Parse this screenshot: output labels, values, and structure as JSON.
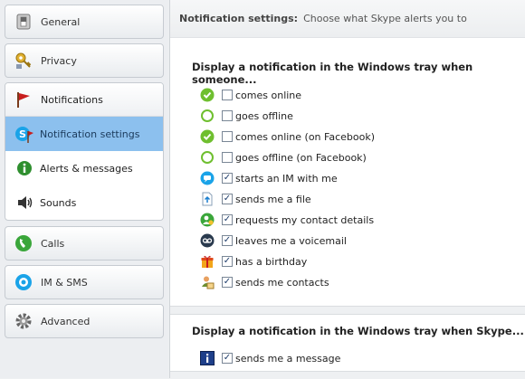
{
  "sidebar": {
    "general": {
      "label": "General",
      "icon": "switch-icon"
    },
    "privacy": {
      "label": "Privacy",
      "icon": "key-icon"
    },
    "notifications": {
      "label": "Notifications",
      "icon": "flag-icon",
      "items": [
        {
          "label": "Notification settings",
          "icon": "skype-flag-icon",
          "active": true
        },
        {
          "label": "Alerts & messages",
          "icon": "info-icon"
        },
        {
          "label": "Sounds",
          "icon": "speaker-icon"
        }
      ]
    },
    "calls": {
      "label": "Calls",
      "icon": "phone-icon"
    },
    "im_sms": {
      "label": "IM & SMS",
      "icon": "chat-icon"
    },
    "advanced": {
      "label": "Advanced",
      "icon": "gear-icon"
    }
  },
  "header": {
    "title": "Notification settings:",
    "subtitle": "Choose what Skype alerts you to"
  },
  "section1": {
    "title": "Display a notification in the Windows tray when someone...",
    "rows": [
      {
        "label": "comes online",
        "checked": false,
        "icon": "online-check-icon"
      },
      {
        "label": "goes offline",
        "checked": false,
        "icon": "offline-ring-icon"
      },
      {
        "label": "comes online (on Facebook)",
        "checked": false,
        "icon": "online-check-icon"
      },
      {
        "label": "goes offline (on Facebook)",
        "checked": false,
        "icon": "offline-ring-icon"
      },
      {
        "label": "starts an IM with me",
        "checked": true,
        "icon": "chat-bubble-icon"
      },
      {
        "label": "sends me a file",
        "checked": true,
        "icon": "file-transfer-icon"
      },
      {
        "label": "requests my contact details",
        "checked": true,
        "icon": "contact-request-icon"
      },
      {
        "label": "leaves me a voicemail",
        "checked": true,
        "icon": "voicemail-icon"
      },
      {
        "label": "has a birthday",
        "checked": true,
        "icon": "gift-icon"
      },
      {
        "label": "sends me contacts",
        "checked": true,
        "icon": "contacts-icon"
      }
    ]
  },
  "section2": {
    "title": "Display a notification in the Windows tray when Skype...",
    "rows": [
      {
        "label": "sends me a message",
        "checked": true,
        "icon": "info-square-icon"
      }
    ]
  },
  "colors": {
    "active_item": "#8cc0ee",
    "online_green": "#6fbf2f",
    "skype_blue": "#1aa3e8"
  }
}
